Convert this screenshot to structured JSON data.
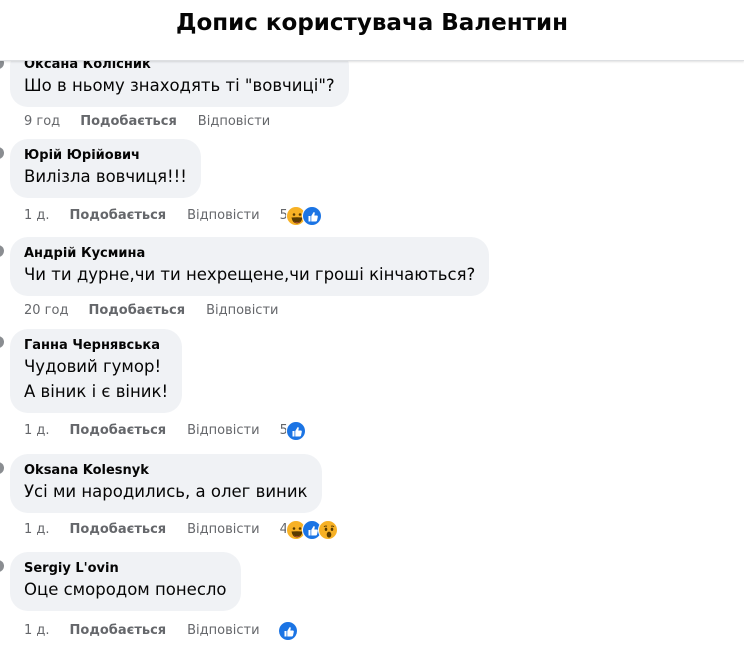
{
  "header": {
    "title": "Допис користувача Валентин"
  },
  "labels": {
    "like": "Подобається",
    "reply": "Відповісти"
  },
  "comments": [
    {
      "author": "Оксана Колісник",
      "lines": [
        "Шо в ньому знаходять ті \"вовчиці\"?"
      ],
      "time": "9 год",
      "reactions": null,
      "reaction_icons": []
    },
    {
      "author": "Юрій Юрійович",
      "lines": [
        "Вилізла вовчиця!!!"
      ],
      "time": "1 д.",
      "reactions": "5",
      "reaction_icons": [
        "haha-icon",
        "like-icon"
      ]
    },
    {
      "author": "Андрій Кусмина",
      "lines": [
        "Чи ти дурне,чи ти нехрещене,чи гроші кінчаються?"
      ],
      "time": "20 год",
      "reactions": null,
      "reaction_icons": []
    },
    {
      "author": "Ганна Чернявська",
      "lines": [
        "Чудовий гумор!",
        "А віник і є віник!"
      ],
      "time": "1 д.",
      "reactions": "5",
      "reaction_icons": [
        "like-icon"
      ]
    },
    {
      "author": "Oksana Kolesnyk",
      "lines": [
        "Усі ми народились, а олег виник"
      ],
      "time": "1 д.",
      "reactions": "4",
      "reaction_icons": [
        "haha-icon",
        "like-icon",
        "wow-icon"
      ]
    },
    {
      "author": "Sergiy L'ovin",
      "lines": [
        "Оце смородом понесло"
      ],
      "time": "1 д.",
      "reactions": "",
      "reaction_icons": [
        "like-icon"
      ]
    }
  ],
  "colors": {
    "bubble": "#f0f2f5",
    "meta": "#65676b",
    "like_blue": "#1b74e4",
    "haha_yellow": "#f7b125"
  }
}
